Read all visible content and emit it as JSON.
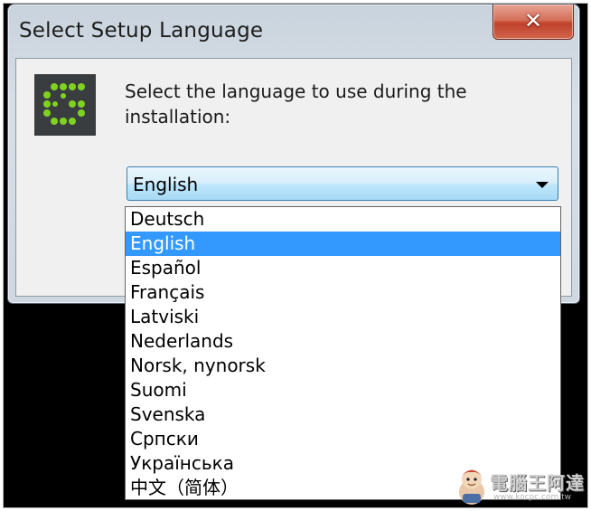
{
  "window": {
    "title": "Select Setup Language",
    "close_glyph": "✕"
  },
  "logo": {
    "icon": "setup-app-logo-icon",
    "accent_color": "#7fd21f"
  },
  "prompt": "Select the language to use during the installation:",
  "language_select": {
    "value": "English",
    "options": [
      "Deutsch",
      "English",
      "Español",
      "Français",
      "Latviski",
      "Nederlands",
      "Norsk, nynorsk",
      "Suomi",
      "Svenska",
      "Српски",
      "Українська",
      "中文（简体）"
    ],
    "highlighted": "English",
    "highlight_color": "#3399ff"
  },
  "watermark": {
    "brand": "電腦王阿達",
    "url": "www.kocpc.com.tw"
  }
}
